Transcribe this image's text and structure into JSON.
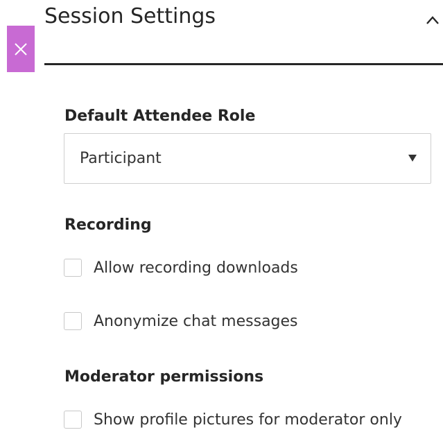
{
  "panel": {
    "title": "Session Settings",
    "close_icon": "close-icon",
    "collapse_icon": "chevron-up-icon",
    "accent_color": "#c86ad3"
  },
  "default_role": {
    "heading": "Default Attendee Role",
    "selected": "Participant",
    "caret_icon": "caret-down-icon"
  },
  "recording": {
    "heading": "Recording",
    "options": [
      {
        "label": "Allow recording downloads",
        "checked": false
      },
      {
        "label": "Anonymize chat messages",
        "checked": false
      }
    ]
  },
  "moderator": {
    "heading": "Moderator permissions",
    "options": [
      {
        "label": "Show profile pictures for moderator only",
        "checked": false
      }
    ]
  }
}
